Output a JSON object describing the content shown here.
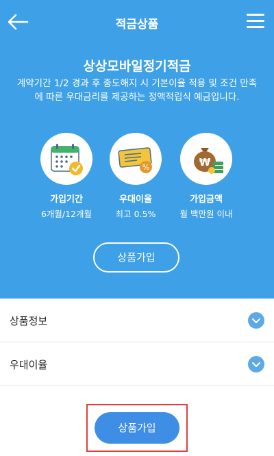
{
  "header": {
    "title": "적금상품",
    "back_icon": "arrow-left-icon",
    "menu_icon": "hamburger-menu-icon"
  },
  "product": {
    "name": "상상모바일정기적금",
    "description": "계약기간 1/2 경과 후 중도해지 시 기본이율 적용 및 조건 만족에 따른 우대금리를 제공하는 정액적립식 예금입니다."
  },
  "features": [
    {
      "icon": "calendar-icon",
      "label": "가입기간",
      "value": "6개월/12개월"
    },
    {
      "icon": "coupon-icon",
      "label": "우대이율",
      "value": "최고 0.5%"
    },
    {
      "icon": "money-bag-icon",
      "label": "가입금액",
      "value": "월 백만원 이내"
    }
  ],
  "hero_button": {
    "label": "상품가입"
  },
  "accordion": [
    {
      "label": "상품정보"
    },
    {
      "label": "우대이율"
    }
  ],
  "cta": {
    "label": "상품가입"
  },
  "colors": {
    "primary": "#3ea0e6",
    "button": "#3f8ee6",
    "highlight": "#e0403a"
  }
}
